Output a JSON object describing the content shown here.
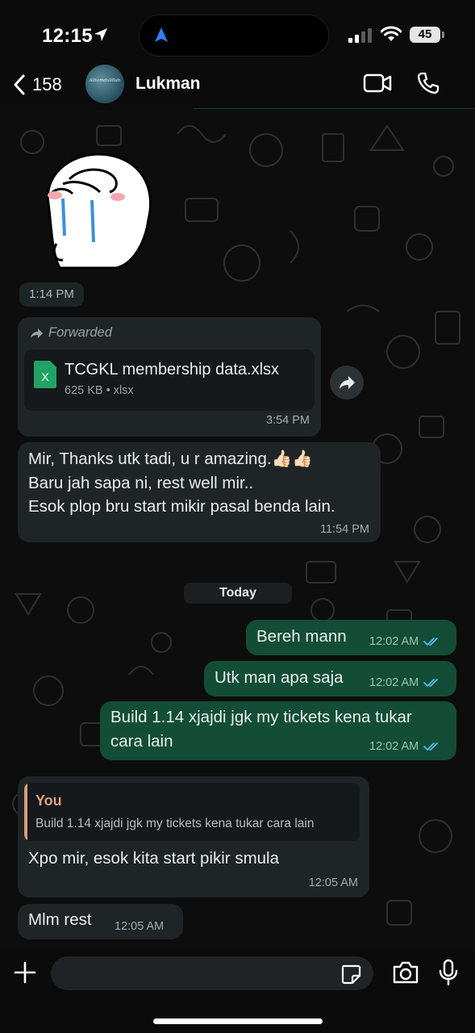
{
  "status_bar": {
    "time": "12:15",
    "battery": "45"
  },
  "header": {
    "back_count": "158",
    "contact_name": "Lukman",
    "avatar_text": "Alhamdulillah"
  },
  "messages": {
    "sticker": {
      "time": "1:14 PM"
    },
    "forwarded_file": {
      "forwarded_label": "Forwarded",
      "file_name": "TCGKL membership data.xlsx",
      "file_info": "625 KB • xlsx",
      "time": "3:54 PM"
    },
    "thanks": {
      "line1": "Mir, Thanks utk tadi, u r amazing.👍🏻👍🏻",
      "line2": "Baru jah sapa ni, rest well mir..",
      "line3": "Esok plop bru start mikir pasal benda lain.",
      "time": "11:54 PM"
    },
    "date_separator": "Today",
    "out1": {
      "text": "Bereh mann",
      "time": "12:02 AM"
    },
    "out2": {
      "text": "Utk man apa saja",
      "time": "12:02 AM"
    },
    "out3": {
      "line1": "Build 1.14 xjajdi jgk my tickets kena tukar",
      "line2": "cara lain",
      "time": "12:02 AM"
    },
    "reply": {
      "quote_author": "You",
      "quote_text": "Build 1.14 xjajdi jgk my tickets kena tukar cara lain",
      "text": "Xpo mir, esok kita start pikir smula",
      "time": "12:05 AM"
    },
    "last": {
      "text": "Mlm rest",
      "time": "12:05 AM"
    }
  },
  "composer": {
    "placeholder": ""
  },
  "colors": {
    "outgoing_bubble": "#134d37",
    "incoming_bubble": "#1f2427",
    "read_ticks": "#53bdeb",
    "quote_accent": "#dea07f"
  }
}
